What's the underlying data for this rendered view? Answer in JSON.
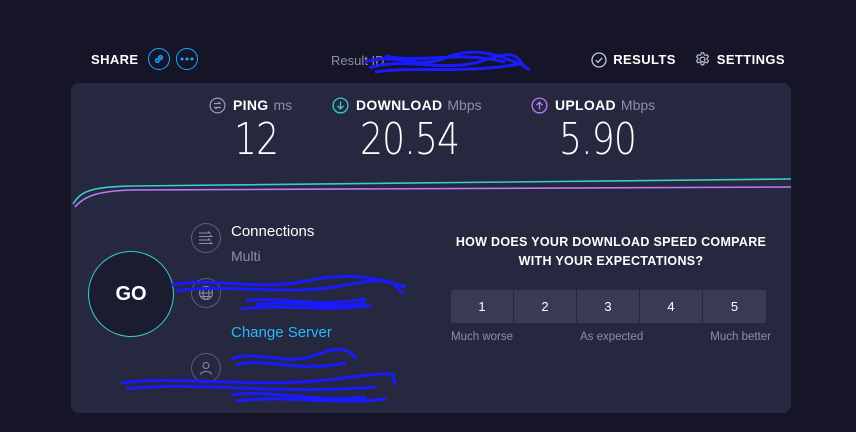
{
  "header": {
    "share_label": "SHARE",
    "share_icons": [
      "link-icon",
      "more-icon"
    ],
    "result_id_label": "Result ID",
    "results_label": "RESULTS",
    "settings_label": "SETTINGS",
    "accent_color": "#1ea7ff"
  },
  "metrics": {
    "ping": {
      "label": "PING",
      "unit": "ms",
      "value": "12",
      "icon": "ping-icon",
      "color": "#9a9cb8"
    },
    "download": {
      "label": "DOWNLOAD",
      "unit": "Mbps",
      "value": "20.54",
      "icon": "download-icon",
      "color": "#34d0c9"
    },
    "upload": {
      "label": "UPLOAD",
      "unit": "Mbps",
      "value": "5.90",
      "icon": "upload-icon",
      "color": "#b77cf7"
    }
  },
  "go_label": "GO",
  "connections": {
    "title": "Connections",
    "value": "Multi",
    "icon": "connections-icon"
  },
  "server": {
    "change_label": "Change Server",
    "icon": "globe-icon"
  },
  "user": {
    "icon": "user-icon"
  },
  "survey": {
    "question_line1": "HOW DOES YOUR DOWNLOAD SPEED COMPARE",
    "question_line2": "WITH YOUR EXPECTATIONS?",
    "ratings": [
      "1",
      "2",
      "3",
      "4",
      "5"
    ],
    "legend_low": "Much worse",
    "legend_mid": "As expected",
    "legend_high": "Much better"
  }
}
